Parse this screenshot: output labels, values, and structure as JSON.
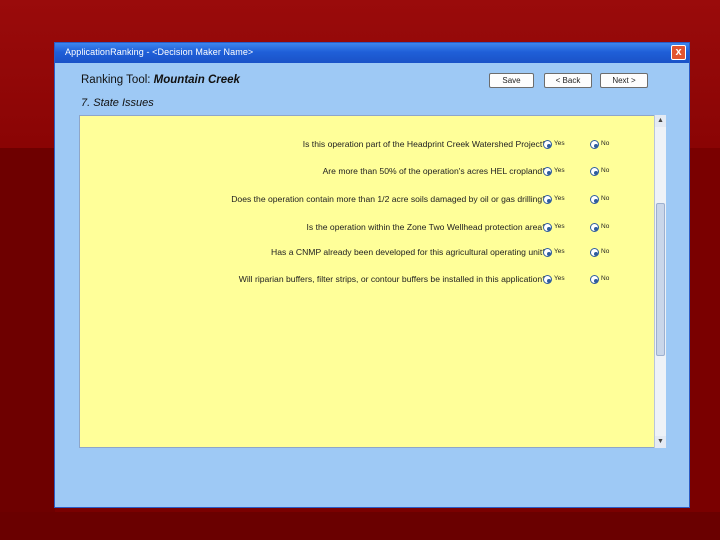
{
  "window": {
    "title": "ApplicationRanking - <Decision Maker Name>",
    "close_label": "x"
  },
  "header": {
    "heading_prefix": "Ranking Tool: ",
    "site_name": "Mountain Creek",
    "section_title": "7. State Issues"
  },
  "toolbar": {
    "save_label": "Save",
    "back_label": "< Back",
    "next_label": "Next >"
  },
  "questions": [
    {
      "text": "Is this operation part of the Headprint Creek Watershed Project?",
      "yes": "Yes",
      "no": "No"
    },
    {
      "text": "Are more than 50% of the operation's acres HEL cropland?",
      "yes": "Yes",
      "no": "No"
    },
    {
      "text": "Does the operation contain more than 1/2 acre soils damaged by oil or gas drilling?",
      "yes": "Yes",
      "no": "No"
    },
    {
      "text": "Is the operation within the Zone Two Wellhead protection area?",
      "yes": "Yes",
      "no": "No"
    },
    {
      "text": "Has a CNMP already been developed for this agricultural operating unit?",
      "yes": "Yes",
      "no": "No"
    },
    {
      "text": "Will riparian buffers, filter strips, or contour buffers be installed in this application?",
      "yes": "Yes",
      "no": "No"
    }
  ],
  "scrollbar": {
    "up_arrow": "▲",
    "down_arrow": "▼"
  }
}
